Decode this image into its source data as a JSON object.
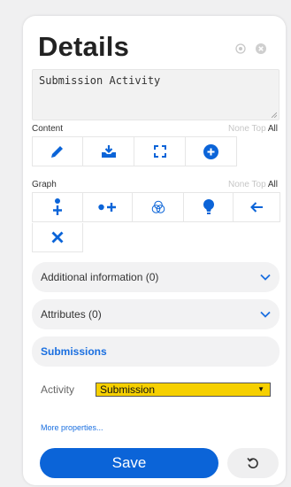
{
  "header": {
    "title": "Details",
    "icons": [
      "locate-icon",
      "close-icon"
    ]
  },
  "description": {
    "value": "Submission Activity"
  },
  "content_section": {
    "label": "Content",
    "filters": {
      "none": "None",
      "top": "Top",
      "all": "All"
    },
    "tools": [
      "edit-icon",
      "download-icon",
      "fullscreen-icon",
      "add-circle-icon"
    ]
  },
  "graph_section": {
    "label": "Graph",
    "filters": {
      "none": "None",
      "top": "Top",
      "all": "All"
    },
    "tools": [
      "add-child-icon",
      "add-related-icon",
      "circles-icon",
      "bulb-icon",
      "arrow-left-icon",
      "close-x-icon"
    ]
  },
  "accordions": {
    "additional": "Additional information (0)",
    "attributes": "Attributes (0)",
    "submissions": "Submissions"
  },
  "activity": {
    "label": "Activity",
    "selected": "Submission",
    "highlight_color": "#f6d000"
  },
  "more_properties": "More properties...",
  "save_label": "Save",
  "colors": {
    "accent": "#0b64d8",
    "link": "#1a6fe0"
  }
}
